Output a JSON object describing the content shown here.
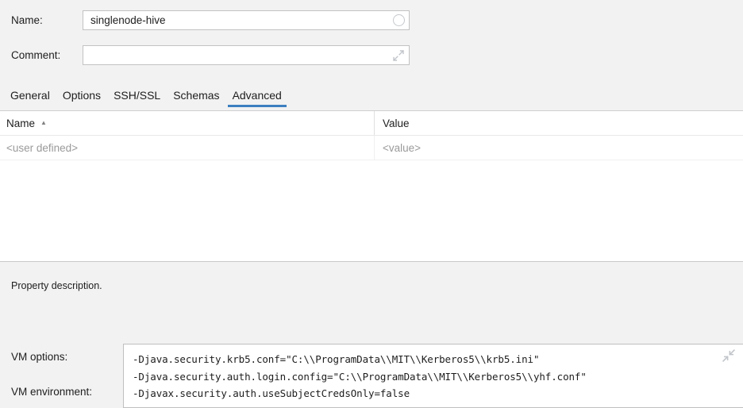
{
  "form": {
    "name_label": "Name:",
    "name_value": "singlenode-hive",
    "name_status_icon": "circle-icon",
    "comment_label": "Comment:",
    "comment_value": "",
    "comment_placeholder": "",
    "comment_expand_icon": "expand-icon"
  },
  "tabs": [
    {
      "label": "General",
      "active": false
    },
    {
      "label": "Options",
      "active": false
    },
    {
      "label": "SSH/SSL",
      "active": false
    },
    {
      "label": "Schemas",
      "active": false
    },
    {
      "label": "Advanced",
      "active": true
    }
  ],
  "table": {
    "columns": [
      {
        "label": "Name",
        "sort": "ascending",
        "sort_glyph": "▲"
      },
      {
        "label": "Value",
        "sort": "none",
        "sort_glyph": ""
      }
    ],
    "rows": [
      {
        "name": "<user defined>",
        "value": "<value>"
      }
    ]
  },
  "description": {
    "text": "Property description."
  },
  "vm": {
    "options_label": "VM options:",
    "environment_label": "VM environment:",
    "options_value": "-Djava.security.krb5.conf=\"C:\\\\ProgramData\\\\MIT\\\\Kerberos5\\\\krb5.ini\"\n-Djava.security.auth.login.config=\"C:\\\\ProgramData\\\\MIT\\\\Kerberos5\\\\yhf.conf\"\n-Djavax.security.auth.useSubjectCredsOnly=false",
    "collapse_icon": "collapse-icon"
  },
  "colors": {
    "accent": "#3c7fc0",
    "panel_bg": "#f2f2f2",
    "field_bg": "#ffffff",
    "border": "#c2c2c2",
    "placeholder_text": "#9a9a9a",
    "text": "#1d1d1d"
  }
}
